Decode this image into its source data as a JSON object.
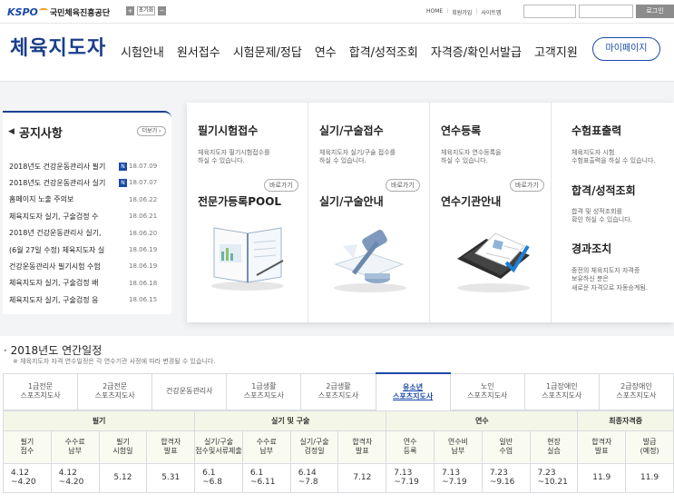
{
  "utility": {
    "logo_text": "KSPO",
    "org_name": "국민체육진흥공단",
    "reset_label": "초기화",
    "home": "HOME",
    "join": "회원가입",
    "sitemap": "사이트맵",
    "login": "로그인",
    "id_placeholder": "",
    "pw_placeholder": ""
  },
  "gnb": {
    "title": "체육지도자",
    "menu": [
      "시험안내",
      "원서접수",
      "시험문제/정답",
      "연수",
      "합격/성적조회",
      "자격증/확인서발급",
      "고객지원"
    ],
    "mypage": "마이페이지"
  },
  "notice": {
    "title": "공지사항",
    "more": "더보기",
    "items": [
      {
        "title": "2018년도 건강운동관리사 필기",
        "new": true,
        "date": "18.07.09"
      },
      {
        "title": "2018년도 건강운동관리사 실기",
        "new": true,
        "date": "18.07.07"
      },
      {
        "title": "홈페이지 노출 주의보",
        "new": false,
        "date": "18.06.22"
      },
      {
        "title": "체육지도자 실기, 구술검정 수",
        "new": false,
        "date": "18.06.21"
      },
      {
        "title": "2018년 건강운동관리사 실기,",
        "new": false,
        "date": "18.06.20"
      },
      {
        "title": "(6월 27일 수정) 체육지도자 실",
        "new": false,
        "date": "18.06.19"
      },
      {
        "title": "건강운동관리사 필기시험 수험",
        "new": false,
        "date": "18.06.19"
      },
      {
        "title": "체육지도자 실기, 구술검정 배",
        "new": false,
        "date": "18.06.18"
      },
      {
        "title": "체육지도자 실기, 구술검정 응",
        "new": false,
        "date": "18.06.15"
      }
    ],
    "new_badge": "N"
  },
  "services": {
    "col1": {
      "title": "필기시험접수",
      "desc1": "체육지도자 필기시험접수를",
      "desc2": "하실 수 있습니다.",
      "btn": "바로가기",
      "title2": "전문가등록POOL"
    },
    "col2": {
      "title": "실기/구술접수",
      "desc1": "체육지도자 실기/구술 접수를",
      "desc2": "하실 수 있습니다.",
      "btn": "바로가기",
      "title2": "실기/구술안내"
    },
    "col3": {
      "title": "연수등록",
      "desc1": "체육지도자 연수등록을",
      "desc2": "하실 수 있습니다.",
      "btn": "바로가기",
      "title2": "연수기관안내"
    },
    "col4": {
      "title": "수험표출력",
      "desc1": "체육지도자 시험",
      "desc2": "수험표출력을 하실 수 있습니다.",
      "title2": "합격/성적조회",
      "desc3": "합격 및 성적조회를",
      "desc4": "확인 하실 수 있습니다.",
      "title3": "경과조치",
      "desc5": "종전의 체육지도자 자격증",
      "desc6": "보유하신 분은",
      "desc7": "새로운 자격으로 자동승계됨."
    }
  },
  "schedule": {
    "title": "2018년도 연간일정",
    "note": "※ 체육지도자 자격 연수일정은 각 연수기관 사정에 따라 변경될 수 있습니다.",
    "tabs": [
      {
        "l1": "1급전문",
        "l2": "스포츠지도사"
      },
      {
        "l1": "2급전문",
        "l2": "스포츠지도사"
      },
      {
        "l1": "건강운동관리사",
        "l2": ""
      },
      {
        "l1": "1급생활",
        "l2": "스포츠지도사"
      },
      {
        "l1": "2급생활",
        "l2": "스포츠지도사"
      },
      {
        "l1": "유소년",
        "l2": "스포츠지도사"
      },
      {
        "l1": "노인",
        "l2": "스포츠지도사"
      },
      {
        "l1": "1급장애인",
        "l2": "스포츠지도사"
      },
      {
        "l1": "2급장애인",
        "l2": "스포츠지도사"
      }
    ],
    "groups": [
      "필기",
      "실기 및 구술",
      "연수",
      "최종자격증"
    ],
    "headers": [
      {
        "l1": "필기",
        "l2": "접수"
      },
      {
        "l1": "수수료",
        "l2": "납부"
      },
      {
        "l1": "필기",
        "l2": "시험일"
      },
      {
        "l1": "합격자",
        "l2": "발표"
      },
      {
        "l1": "실기/구술",
        "l2": "접수및서류제출"
      },
      {
        "l1": "수수료",
        "l2": "납부"
      },
      {
        "l1": "실기/구술",
        "l2": "검정일"
      },
      {
        "l1": "합격자",
        "l2": "발표"
      },
      {
        "l1": "연수",
        "l2": "등록"
      },
      {
        "l1": "연수비",
        "l2": "납부"
      },
      {
        "l1": "일반",
        "l2": "수업"
      },
      {
        "l1": "현장",
        "l2": "실습"
      },
      {
        "l1": "합격자",
        "l2": "발표"
      },
      {
        "l1": "발급",
        "l2": "(예정)"
      }
    ],
    "values": [
      {
        "l1": "4.12",
        "l2": "~4.20"
      },
      {
        "l1": "4.12",
        "l2": "~4.20"
      },
      {
        "l1": "5.12",
        "l2": ""
      },
      {
        "l1": "5.31",
        "l2": ""
      },
      {
        "l1": "6.1",
        "l2": "~6.8"
      },
      {
        "l1": "6.1",
        "l2": "~6.11"
      },
      {
        "l1": "6.14",
        "l2": "~7.8"
      },
      {
        "l1": "7.12",
        "l2": ""
      },
      {
        "l1": "7.13",
        "l2": "~7.19"
      },
      {
        "l1": "7.13",
        "l2": "~7.19"
      },
      {
        "l1": "7.23",
        "l2": "~9.16"
      },
      {
        "l1": "7.23",
        "l2": "~10.21"
      },
      {
        "l1": "11.9",
        "l2": ""
      },
      {
        "l1": "11.9",
        "l2": ""
      }
    ]
  }
}
